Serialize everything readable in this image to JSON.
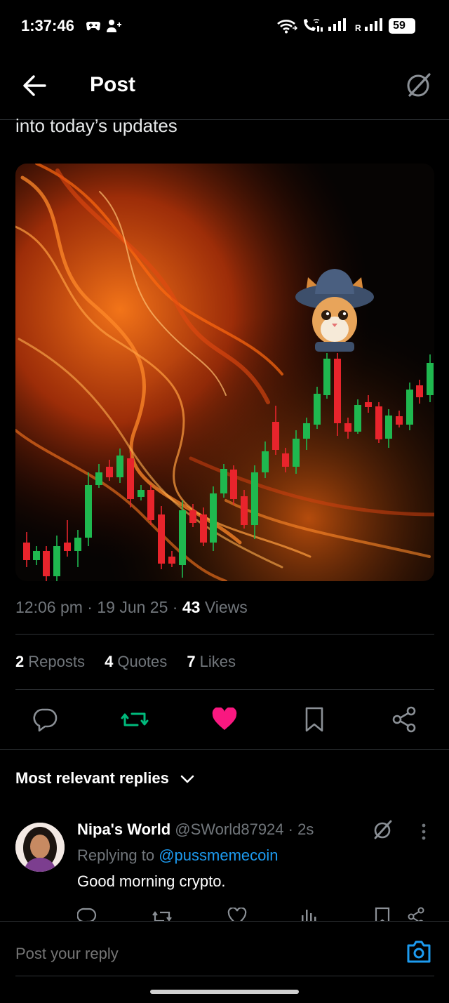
{
  "status_bar": {
    "time": "1:37:46",
    "battery": "59",
    "icons": [
      "gamepad-icon",
      "person-add-icon",
      "wifi-icon",
      "wifi-call-icon",
      "signal-icon",
      "signal-roaming-icon",
      "battery-icon"
    ],
    "roaming_label": "R"
  },
  "header": {
    "title": "Post",
    "icons": [
      "back-arrow-icon",
      "grok-icon"
    ]
  },
  "post": {
    "text_fragment": "into today’s updates",
    "time": "12:06 pm",
    "date": "19 Jun 25",
    "views_count": "43",
    "views_label": "Views",
    "reposts_count": "2",
    "reposts_label": "Reposts",
    "quotes_count": "4",
    "quotes_label": "Quotes",
    "likes_count": "7",
    "likes_label": "Likes",
    "actions": [
      "reply-icon",
      "repost-icon",
      "like-icon",
      "bookmark-icon",
      "share-icon"
    ],
    "colors": {
      "repost": "#00ba7c",
      "like": "#f91880",
      "link": "#1d9bf0",
      "candle_up": "#1fb84f",
      "candle_down": "#e8242c"
    }
  },
  "replies": {
    "sort_label": "Most relevant replies",
    "items": [
      {
        "display_name": "Nipa's World",
        "handle": "@SWorld87924",
        "age": "2s",
        "replying_prefix": "Replying to",
        "replying_to": "@pussmemecoin",
        "text": "Good morning crypto."
      }
    ]
  },
  "composer": {
    "placeholder": "Post your reply"
  }
}
